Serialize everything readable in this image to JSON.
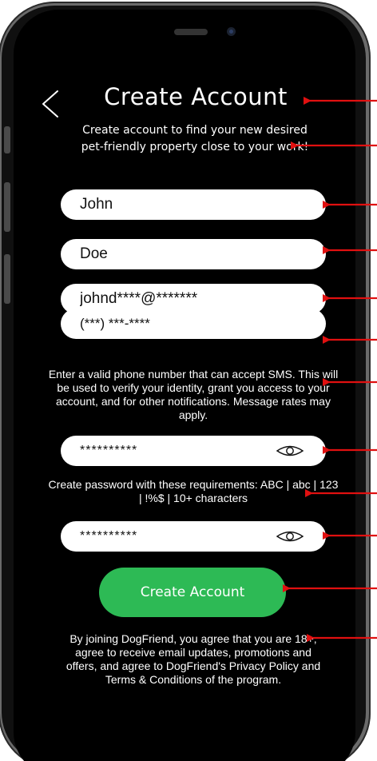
{
  "header": {
    "title": "Create Account",
    "subtitle": "Create account to find your new desired pet-friendly property close to your work!"
  },
  "form": {
    "first_name": {
      "value": "John"
    },
    "last_name": {
      "value": "Doe"
    },
    "email": {
      "value": "johnd****@*******"
    },
    "phone": {
      "value": "(***) ***-****"
    },
    "phone_helper": "Enter a valid phone number that can accept SMS. This will be used to verify your identity, grant you access to your account, and for other notifications. Message rates may apply.",
    "password": {
      "value": "**********"
    },
    "password_helper": "Create password with these requirements: ABC | abc | 123 | !%$ | 10+ characters",
    "confirm_password": {
      "value": "**********"
    }
  },
  "actions": {
    "create_label": "Create Account"
  },
  "legal": {
    "text": "By joining DogFriend, you agree that you are 18+, agree to receive email updates, promotions and offers, and agree to DogFriend's Privacy Policy and Terms & Conditions of the program."
  },
  "icons": {
    "back": "chevron-left-icon",
    "password_toggle": "eye-icon"
  },
  "colors": {
    "screen_background": "#000000",
    "text": "#ffffff",
    "field_background": "#ffffff",
    "primary_button": "#2dba55",
    "annotation_arrow": "#e01010"
  }
}
